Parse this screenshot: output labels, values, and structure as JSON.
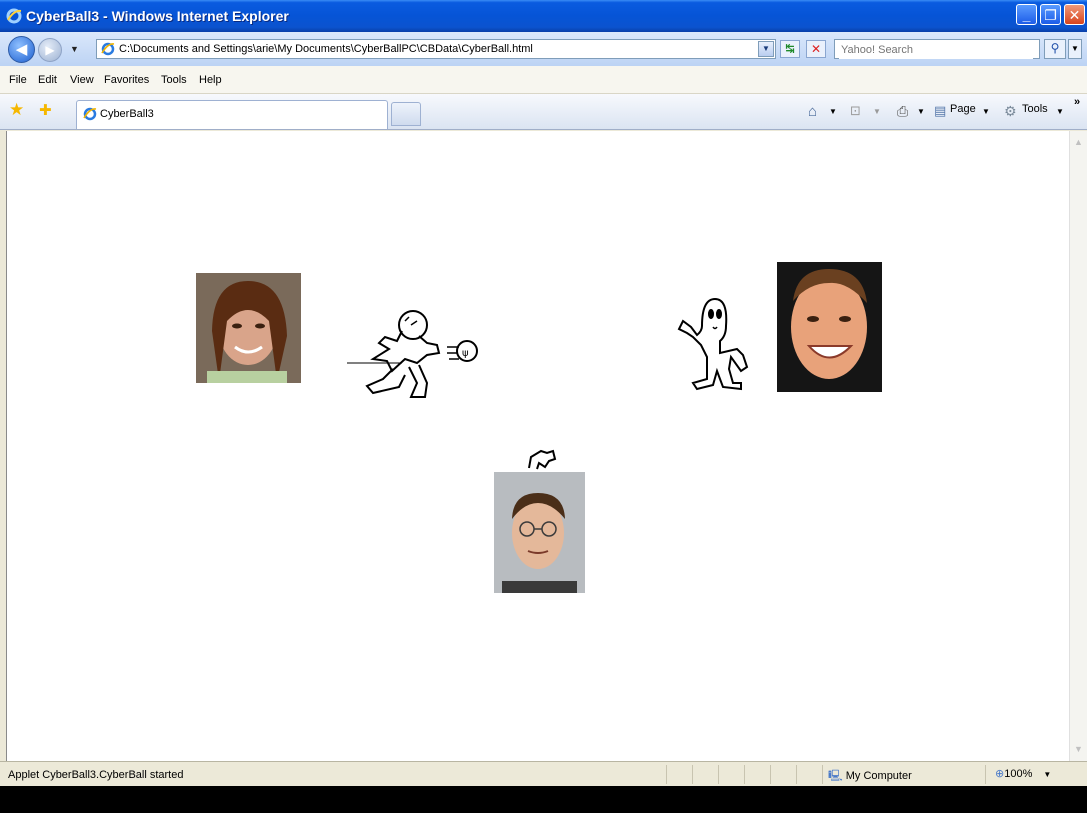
{
  "window": {
    "title": "CyberBall3 - Windows Internet Explorer",
    "minimize": "_",
    "maximize": "❐",
    "close": "✕"
  },
  "address": {
    "url": "C:\\Documents and Settings\\arie\\My Documents\\CyberBallPC\\CBData\\CyberBall.html",
    "search_placeholder": "Yahoo! Search"
  },
  "menu": [
    "File",
    "Edit",
    "View",
    "Favorites",
    "Tools",
    "Help"
  ],
  "tab": {
    "label": "CyberBall3"
  },
  "commandbar": {
    "page": "Page",
    "tools": "Tools",
    "more": "»"
  },
  "status": {
    "text": "Applet CyberBall3.CyberBall started",
    "zone": "My Computer",
    "zoom": "100%"
  },
  "game": {
    "players": [
      {
        "name": "left-player",
        "skin": "#d9a48a",
        "hair": "#5a2c12",
        "bg": "#7a6a5a"
      },
      {
        "name": "right-player",
        "skin": "#e8a27a",
        "hair": "#6a4020",
        "bg": "#151515"
      },
      {
        "name": "bottom-player",
        "skin": "#e4b89a",
        "hair": "#4a2e18",
        "bg": "#b8bcc0"
      }
    ],
    "ball_holder": "left-player"
  }
}
